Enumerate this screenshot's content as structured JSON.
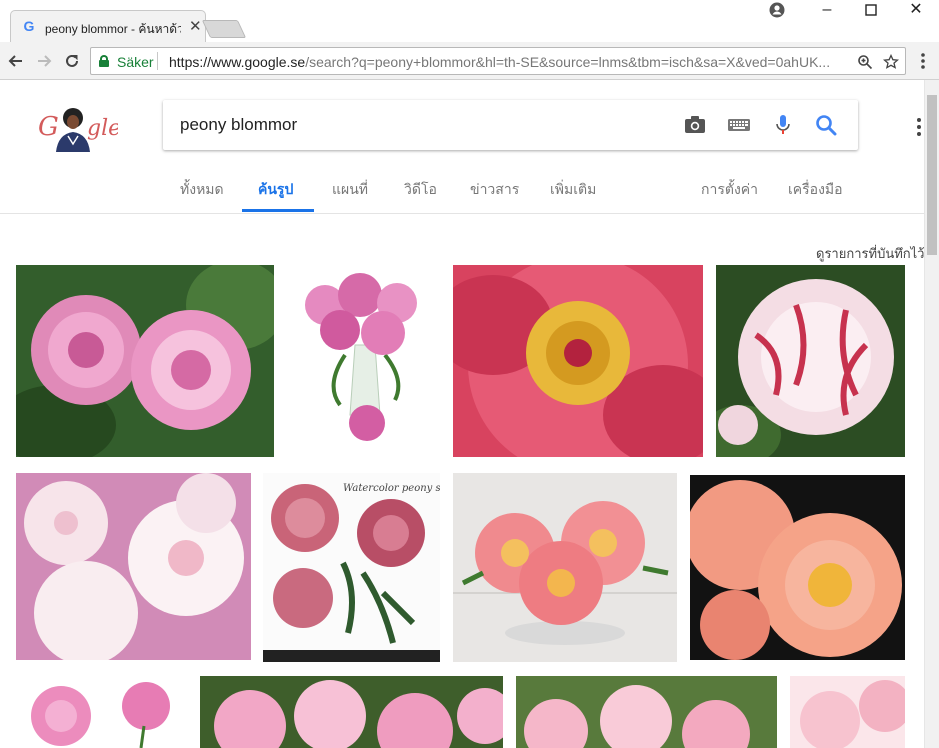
{
  "browser": {
    "tab_title": "peony blommor - ค้นหาด้วย Google",
    "secure_label": "Säker",
    "url_host": "https://www.google.se",
    "url_path": "/search?q=peony+blommor&hl=th-SE&source=lnms&tbm=isch&sa=X&ved=0ahUK..."
  },
  "search": {
    "query": "peony blommor"
  },
  "tabs": [
    {
      "label": "ทั้งหมด",
      "active": false
    },
    {
      "label": "ค้นรูป",
      "active": true
    },
    {
      "label": "แผนที่",
      "active": false
    },
    {
      "label": "วิดีโอ",
      "active": false
    },
    {
      "label": "ข่าวสาร",
      "active": false
    },
    {
      "label": "เพิ่มเติม",
      "active": false
    }
  ],
  "tools": {
    "settings": "การตั้งค่า",
    "tools": "เครื่องมือ"
  },
  "saved_link": "ดูรายการที่บันทึกไว้",
  "colors": {
    "accent": "#1a73e8",
    "secure": "#188038"
  },
  "results": [
    {
      "desc": "pink peonies in garden"
    },
    {
      "desc": "pink peony bouquet in vase"
    },
    {
      "desc": "red peony with yellow center"
    },
    {
      "desc": "white and red striped peony"
    },
    {
      "desc": "white and pink peonies"
    },
    {
      "desc": "watercolor peony set"
    },
    {
      "desc": "coral peony bowl"
    },
    {
      "desc": "coral peony close-up"
    },
    {
      "desc": "pink peony illustration"
    },
    {
      "desc": "pink peonies field"
    },
    {
      "desc": "pink peony bed"
    },
    {
      "desc": "light pink peonies"
    }
  ],
  "watermark_text": "Watercolor peony set",
  "icons": {
    "camera": "camera-icon",
    "keyboard": "keyboard-icon",
    "mic": "mic-icon",
    "search": "search-icon"
  }
}
